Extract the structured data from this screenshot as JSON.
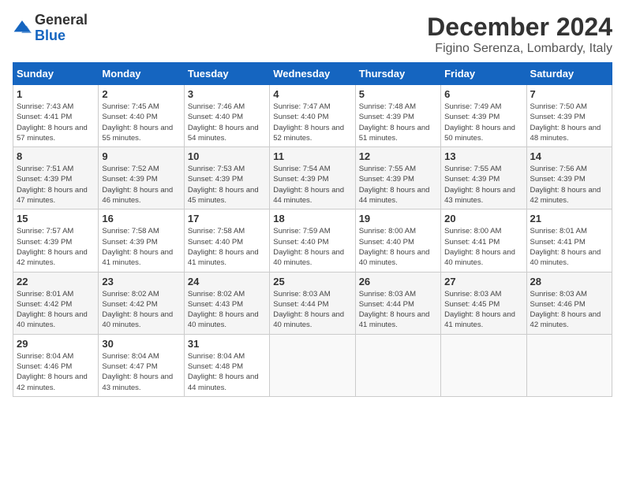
{
  "header": {
    "logo_general": "General",
    "logo_blue": "Blue",
    "month_title": "December 2024",
    "location": "Figino Serenza, Lombardy, Italy"
  },
  "weekdays": [
    "Sunday",
    "Monday",
    "Tuesday",
    "Wednesday",
    "Thursday",
    "Friday",
    "Saturday"
  ],
  "weeks": [
    [
      {
        "day": "1",
        "sunrise": "7:43 AM",
        "sunset": "4:41 PM",
        "daylight": "8 hours and 57 minutes."
      },
      {
        "day": "2",
        "sunrise": "7:45 AM",
        "sunset": "4:40 PM",
        "daylight": "8 hours and 55 minutes."
      },
      {
        "day": "3",
        "sunrise": "7:46 AM",
        "sunset": "4:40 PM",
        "daylight": "8 hours and 54 minutes."
      },
      {
        "day": "4",
        "sunrise": "7:47 AM",
        "sunset": "4:40 PM",
        "daylight": "8 hours and 52 minutes."
      },
      {
        "day": "5",
        "sunrise": "7:48 AM",
        "sunset": "4:39 PM",
        "daylight": "8 hours and 51 minutes."
      },
      {
        "day": "6",
        "sunrise": "7:49 AM",
        "sunset": "4:39 PM",
        "daylight": "8 hours and 50 minutes."
      },
      {
        "day": "7",
        "sunrise": "7:50 AM",
        "sunset": "4:39 PM",
        "daylight": "8 hours and 48 minutes."
      }
    ],
    [
      {
        "day": "8",
        "sunrise": "7:51 AM",
        "sunset": "4:39 PM",
        "daylight": "8 hours and 47 minutes."
      },
      {
        "day": "9",
        "sunrise": "7:52 AM",
        "sunset": "4:39 PM",
        "daylight": "8 hours and 46 minutes."
      },
      {
        "day": "10",
        "sunrise": "7:53 AM",
        "sunset": "4:39 PM",
        "daylight": "8 hours and 45 minutes."
      },
      {
        "day": "11",
        "sunrise": "7:54 AM",
        "sunset": "4:39 PM",
        "daylight": "8 hours and 44 minutes."
      },
      {
        "day": "12",
        "sunrise": "7:55 AM",
        "sunset": "4:39 PM",
        "daylight": "8 hours and 44 minutes."
      },
      {
        "day": "13",
        "sunrise": "7:55 AM",
        "sunset": "4:39 PM",
        "daylight": "8 hours and 43 minutes."
      },
      {
        "day": "14",
        "sunrise": "7:56 AM",
        "sunset": "4:39 PM",
        "daylight": "8 hours and 42 minutes."
      }
    ],
    [
      {
        "day": "15",
        "sunrise": "7:57 AM",
        "sunset": "4:39 PM",
        "daylight": "8 hours and 42 minutes."
      },
      {
        "day": "16",
        "sunrise": "7:58 AM",
        "sunset": "4:39 PM",
        "daylight": "8 hours and 41 minutes."
      },
      {
        "day": "17",
        "sunrise": "7:58 AM",
        "sunset": "4:40 PM",
        "daylight": "8 hours and 41 minutes."
      },
      {
        "day": "18",
        "sunrise": "7:59 AM",
        "sunset": "4:40 PM",
        "daylight": "8 hours and 40 minutes."
      },
      {
        "day": "19",
        "sunrise": "8:00 AM",
        "sunset": "4:40 PM",
        "daylight": "8 hours and 40 minutes."
      },
      {
        "day": "20",
        "sunrise": "8:00 AM",
        "sunset": "4:41 PM",
        "daylight": "8 hours and 40 minutes."
      },
      {
        "day": "21",
        "sunrise": "8:01 AM",
        "sunset": "4:41 PM",
        "daylight": "8 hours and 40 minutes."
      }
    ],
    [
      {
        "day": "22",
        "sunrise": "8:01 AM",
        "sunset": "4:42 PM",
        "daylight": "8 hours and 40 minutes."
      },
      {
        "day": "23",
        "sunrise": "8:02 AM",
        "sunset": "4:42 PM",
        "daylight": "8 hours and 40 minutes."
      },
      {
        "day": "24",
        "sunrise": "8:02 AM",
        "sunset": "4:43 PM",
        "daylight": "8 hours and 40 minutes."
      },
      {
        "day": "25",
        "sunrise": "8:03 AM",
        "sunset": "4:44 PM",
        "daylight": "8 hours and 40 minutes."
      },
      {
        "day": "26",
        "sunrise": "8:03 AM",
        "sunset": "4:44 PM",
        "daylight": "8 hours and 41 minutes."
      },
      {
        "day": "27",
        "sunrise": "8:03 AM",
        "sunset": "4:45 PM",
        "daylight": "8 hours and 41 minutes."
      },
      {
        "day": "28",
        "sunrise": "8:03 AM",
        "sunset": "4:46 PM",
        "daylight": "8 hours and 42 minutes."
      }
    ],
    [
      {
        "day": "29",
        "sunrise": "8:04 AM",
        "sunset": "4:46 PM",
        "daylight": "8 hours and 42 minutes."
      },
      {
        "day": "30",
        "sunrise": "8:04 AM",
        "sunset": "4:47 PM",
        "daylight": "8 hours and 43 minutes."
      },
      {
        "day": "31",
        "sunrise": "8:04 AM",
        "sunset": "4:48 PM",
        "daylight": "8 hours and 44 minutes."
      },
      null,
      null,
      null,
      null
    ]
  ]
}
